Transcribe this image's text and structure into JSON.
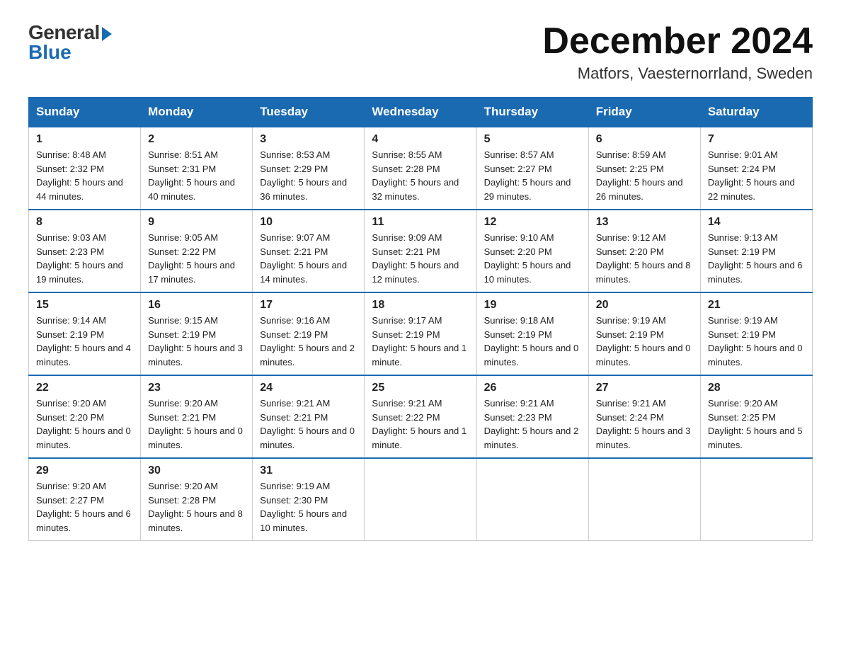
{
  "logo": {
    "general": "General",
    "blue": "Blue"
  },
  "title": "December 2024",
  "location": "Matfors, Vaesternorrland, Sweden",
  "days_of_week": [
    "Sunday",
    "Monday",
    "Tuesday",
    "Wednesday",
    "Thursday",
    "Friday",
    "Saturday"
  ],
  "weeks": [
    [
      {
        "day": "1",
        "sunrise": "8:48 AM",
        "sunset": "2:32 PM",
        "daylight": "5 hours and 44 minutes."
      },
      {
        "day": "2",
        "sunrise": "8:51 AM",
        "sunset": "2:31 PM",
        "daylight": "5 hours and 40 minutes."
      },
      {
        "day": "3",
        "sunrise": "8:53 AM",
        "sunset": "2:29 PM",
        "daylight": "5 hours and 36 minutes."
      },
      {
        "day": "4",
        "sunrise": "8:55 AM",
        "sunset": "2:28 PM",
        "daylight": "5 hours and 32 minutes."
      },
      {
        "day": "5",
        "sunrise": "8:57 AM",
        "sunset": "2:27 PM",
        "daylight": "5 hours and 29 minutes."
      },
      {
        "day": "6",
        "sunrise": "8:59 AM",
        "sunset": "2:25 PM",
        "daylight": "5 hours and 26 minutes."
      },
      {
        "day": "7",
        "sunrise": "9:01 AM",
        "sunset": "2:24 PM",
        "daylight": "5 hours and 22 minutes."
      }
    ],
    [
      {
        "day": "8",
        "sunrise": "9:03 AM",
        "sunset": "2:23 PM",
        "daylight": "5 hours and 19 minutes."
      },
      {
        "day": "9",
        "sunrise": "9:05 AM",
        "sunset": "2:22 PM",
        "daylight": "5 hours and 17 minutes."
      },
      {
        "day": "10",
        "sunrise": "9:07 AM",
        "sunset": "2:21 PM",
        "daylight": "5 hours and 14 minutes."
      },
      {
        "day": "11",
        "sunrise": "9:09 AM",
        "sunset": "2:21 PM",
        "daylight": "5 hours and 12 minutes."
      },
      {
        "day": "12",
        "sunrise": "9:10 AM",
        "sunset": "2:20 PM",
        "daylight": "5 hours and 10 minutes."
      },
      {
        "day": "13",
        "sunrise": "9:12 AM",
        "sunset": "2:20 PM",
        "daylight": "5 hours and 8 minutes."
      },
      {
        "day": "14",
        "sunrise": "9:13 AM",
        "sunset": "2:19 PM",
        "daylight": "5 hours and 6 minutes."
      }
    ],
    [
      {
        "day": "15",
        "sunrise": "9:14 AM",
        "sunset": "2:19 PM",
        "daylight": "5 hours and 4 minutes."
      },
      {
        "day": "16",
        "sunrise": "9:15 AM",
        "sunset": "2:19 PM",
        "daylight": "5 hours and 3 minutes."
      },
      {
        "day": "17",
        "sunrise": "9:16 AM",
        "sunset": "2:19 PM",
        "daylight": "5 hours and 2 minutes."
      },
      {
        "day": "18",
        "sunrise": "9:17 AM",
        "sunset": "2:19 PM",
        "daylight": "5 hours and 1 minute."
      },
      {
        "day": "19",
        "sunrise": "9:18 AM",
        "sunset": "2:19 PM",
        "daylight": "5 hours and 0 minutes."
      },
      {
        "day": "20",
        "sunrise": "9:19 AM",
        "sunset": "2:19 PM",
        "daylight": "5 hours and 0 minutes."
      },
      {
        "day": "21",
        "sunrise": "9:19 AM",
        "sunset": "2:19 PM",
        "daylight": "5 hours and 0 minutes."
      }
    ],
    [
      {
        "day": "22",
        "sunrise": "9:20 AM",
        "sunset": "2:20 PM",
        "daylight": "5 hours and 0 minutes."
      },
      {
        "day": "23",
        "sunrise": "9:20 AM",
        "sunset": "2:21 PM",
        "daylight": "5 hours and 0 minutes."
      },
      {
        "day": "24",
        "sunrise": "9:21 AM",
        "sunset": "2:21 PM",
        "daylight": "5 hours and 0 minutes."
      },
      {
        "day": "25",
        "sunrise": "9:21 AM",
        "sunset": "2:22 PM",
        "daylight": "5 hours and 1 minute."
      },
      {
        "day": "26",
        "sunrise": "9:21 AM",
        "sunset": "2:23 PM",
        "daylight": "5 hours and 2 minutes."
      },
      {
        "day": "27",
        "sunrise": "9:21 AM",
        "sunset": "2:24 PM",
        "daylight": "5 hours and 3 minutes."
      },
      {
        "day": "28",
        "sunrise": "9:20 AM",
        "sunset": "2:25 PM",
        "daylight": "5 hours and 5 minutes."
      }
    ],
    [
      {
        "day": "29",
        "sunrise": "9:20 AM",
        "sunset": "2:27 PM",
        "daylight": "5 hours and 6 minutes."
      },
      {
        "day": "30",
        "sunrise": "9:20 AM",
        "sunset": "2:28 PM",
        "daylight": "5 hours and 8 minutes."
      },
      {
        "day": "31",
        "sunrise": "9:19 AM",
        "sunset": "2:30 PM",
        "daylight": "5 hours and 10 minutes."
      },
      null,
      null,
      null,
      null
    ]
  ]
}
